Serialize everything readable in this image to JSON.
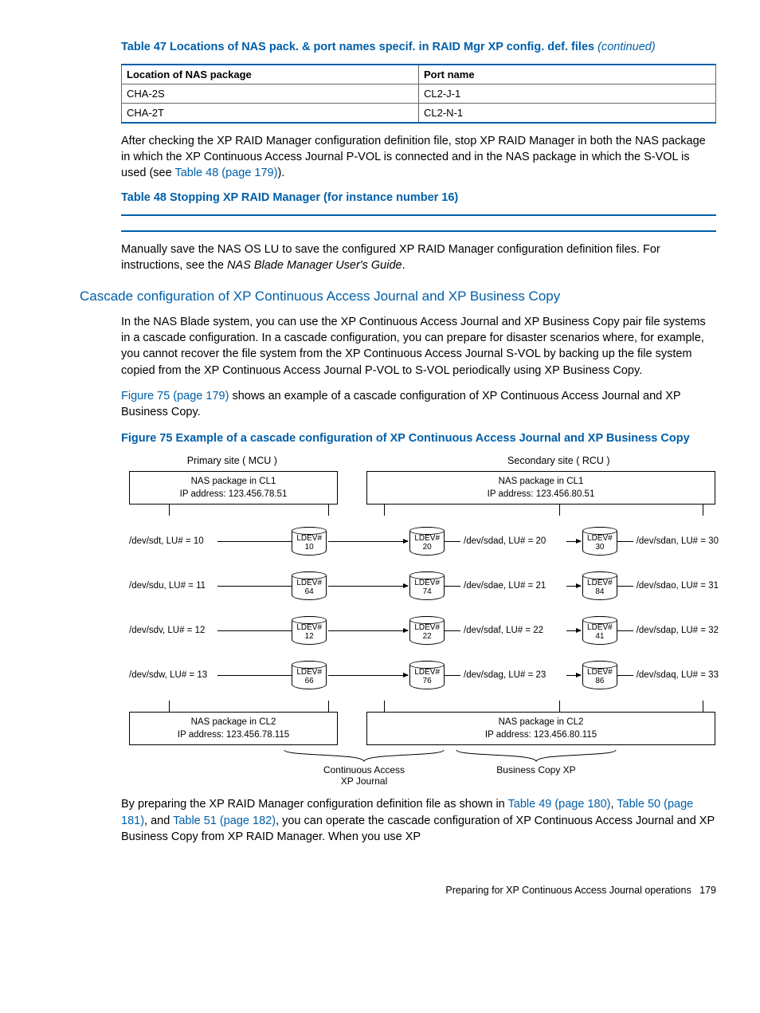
{
  "table47": {
    "caption": "Table 47 Locations of NAS pack. & port names specif. in RAID Mgr XP config. def. files",
    "continued": "(continued)",
    "headers": [
      "Location of NAS package",
      "Port name"
    ],
    "rows": [
      [
        "CHA-2S",
        "CL2-J-1"
      ],
      [
        "CHA-2T",
        "CL2-N-1"
      ]
    ]
  },
  "para1_a": "After checking the XP RAID Manager configuration definition file, stop XP RAID Manager in both the NAS package in which the XP Continuous Access Journal P-VOL is connected and in the NAS package in which the S-VOL is used (see ",
  "para1_link": "Table 48 (page 179)",
  "para1_b": ").",
  "table48_caption": "Table 48 Stopping XP RAID Manager (for instance number 16)",
  "para2_a": "Manually save the NAS OS LU to save the configured XP RAID Manager configuration definition files. For instructions, see the ",
  "para2_i": "NAS Blade Manager User's Guide",
  "para2_b": ".",
  "section_heading": "Cascade configuration of XP Continuous Access Journal and XP Business Copy",
  "para3": "In the NAS Blade system, you can use the XP Continuous Access Journal and XP Business Copy pair file systems in a cascade configuration. In a cascade configuration, you can prepare for disaster scenarios where, for example, you cannot recover the file system from the XP Continuous Access Journal S-VOL by backing up the file system copied from the XP Continuous Access Journal P-VOL to S-VOL periodically using XP Business Copy.",
  "para4_link": "Figure 75 (page 179)",
  "para4_rest": " shows an example of a cascade configuration of XP Continuous Access Journal and XP Business Copy.",
  "figure75_caption": "Figure 75 Example of a cascade configuration of XP Continuous Access Journal and XP Business Copy",
  "diagram": {
    "primary_site": "Primary site ( MCU )",
    "secondary_site": "Secondary site ( RCU )",
    "nas_primary_top_l1": "NAS package in CL1",
    "nas_primary_top_l2": "IP address: 123.456.78.51",
    "nas_secondary_top_l1": "NAS package in CL1",
    "nas_secondary_top_l2": "IP address: 123.456.80.51",
    "nas_primary_bot_l1": "NAS package in CL2",
    "nas_primary_bot_l2": "IP address: 123.456.78.115",
    "nas_secondary_bot_l1": "NAS package in CL2",
    "nas_secondary_bot_l2": "IP address: 123.456.80.115",
    "rows": [
      {
        "left_dev": "/dev/sdt, LU# = 10",
        "left_ldev": "10",
        "mid_dev": "/dev/sdad, LU# = 20",
        "mid_ldev": "20",
        "right_dev": "/dev/sdan, LU# = 30",
        "right_ldev": "30"
      },
      {
        "left_dev": "/dev/sdu, LU# = 11",
        "left_ldev": "64",
        "mid_dev": "/dev/sdae, LU# = 21",
        "mid_ldev": "74",
        "right_dev": "/dev/sdao, LU# = 31",
        "right_ldev": "84"
      },
      {
        "left_dev": "/dev/sdv, LU# = 12",
        "left_ldev": "12",
        "mid_dev": "/dev/sdaf, LU# = 22",
        "mid_ldev": "22",
        "right_dev": "/dev/sdap, LU# = 32",
        "right_ldev": "41"
      },
      {
        "left_dev": "/dev/sdw, LU# = 13",
        "left_ldev": "66",
        "mid_dev": "/dev/sdag, LU# = 23",
        "mid_ldev": "76",
        "right_dev": "/dev/sdaq, LU# = 33",
        "right_ldev": "86"
      }
    ],
    "ldev_label": "LDEV#",
    "conn_left": "Continuous Access",
    "conn_left2": "XP Journal",
    "conn_right": "Business Copy XP"
  },
  "para5_a": "By preparing the XP RAID Manager configuration definition file as shown in ",
  "para5_l1": "Table 49 (page 180)",
  "para5_b": ", ",
  "para5_l2": "Table 50 (page 181)",
  "para5_c": ", and ",
  "para5_l3": "Table 51 (page 182)",
  "para5_d": ", you can operate the cascade configuration of XP Continuous Access Journal and XP Business Copy from XP RAID Manager. When you use XP",
  "footer_text": "Preparing for XP Continuous Access Journal operations",
  "footer_page": "179"
}
